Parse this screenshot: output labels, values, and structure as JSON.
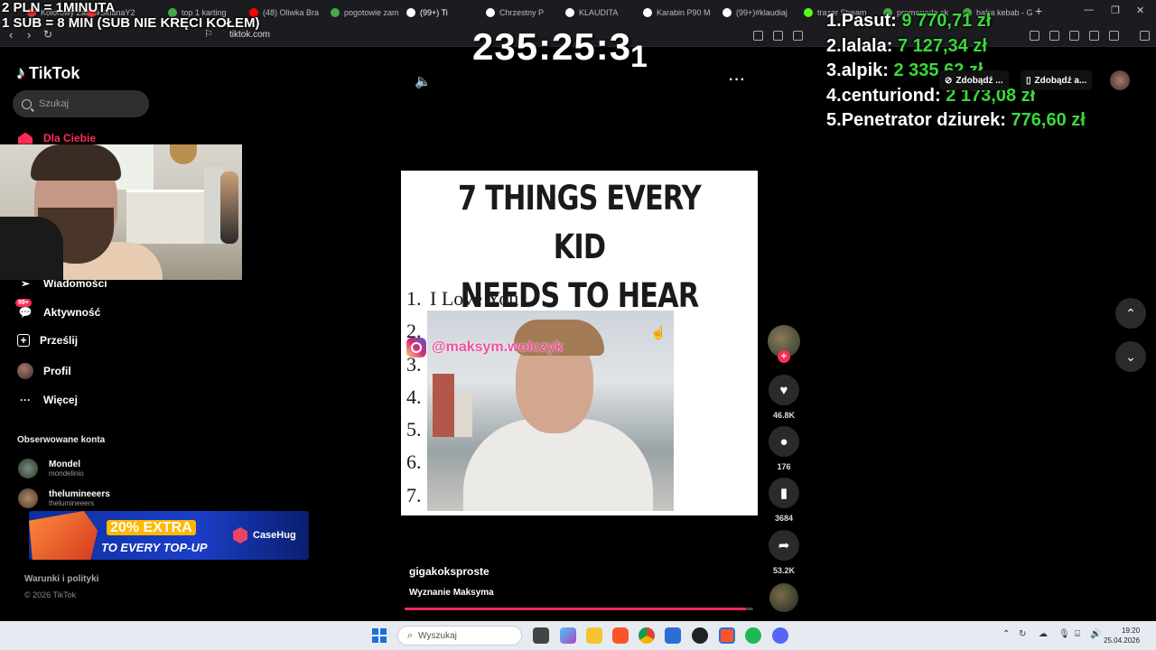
{
  "browser": {
    "tabs": [
      {
        "label": "Kolorowy Zamek",
        "color": "#d33"
      },
      {
        "label": "SklanaY2",
        "color": "#e33"
      },
      {
        "label": "top 1 karting",
        "color": "#4a4"
      },
      {
        "label": "(48) Oliwka Bra",
        "color": "#f00"
      },
      {
        "label": "pogotowie zam",
        "color": "#4a4"
      },
      {
        "label": "(99+) Ti",
        "color": "#fff"
      },
      {
        "label": "Chrzestny P",
        "color": "#fff"
      },
      {
        "label": "KLAUDITA",
        "color": "#fff"
      },
      {
        "label": "Karabin P90 M",
        "color": "#fff"
      },
      {
        "label": "(99+)#klaudiaj",
        "color": "#fff"
      },
      {
        "label": "trazer Stream",
        "color": "#53fc18"
      },
      {
        "label": "promenada sk",
        "color": "#4a4"
      },
      {
        "label": "bafra kebab - G",
        "color": "#4a4"
      }
    ],
    "url": "tiktok.com"
  },
  "stream_overlay": {
    "rate_line": "2 PLN = 1MINUTA",
    "sub_line": "1 SUB = 8 MIN (SUB NIE KRĘCI KOŁEM)",
    "timer": "235:25:3",
    "timer_last_digit": "1",
    "leaderboard": [
      {
        "rank": "1.",
        "name": "Pasut:",
        "amount": "9 770,71 zł"
      },
      {
        "rank": "2.",
        "name": "lalala:",
        "amount": "7 127,34 zł"
      },
      {
        "rank": "3.",
        "name": "alpik:",
        "amount": "2 335,62 zł"
      },
      {
        "rank": "4.",
        "name": "centuriond:",
        "amount": "2 173,08 zł"
      },
      {
        "rank": "5.",
        "name": "Penetrator dziurek:",
        "amount": "776,60 zł"
      }
    ]
  },
  "tiktok": {
    "logo": "TikTok",
    "search_placeholder": "Szukaj",
    "nav": {
      "for_you": "Dla Ciebie",
      "messages": "Wiadomości",
      "activity": "Aktywność",
      "activity_badge": "99+",
      "upload": "Prześlij",
      "profile": "Profil",
      "more": "Więcej"
    },
    "followed_title": "Obserwowane konta",
    "followed": [
      {
        "name": "Mondel",
        "handle": "mondelinio"
      },
      {
        "name": "thelumineeers",
        "handle": "thelumineeers"
      }
    ],
    "footer": {
      "terms": "Warunki i polityki",
      "copyright": "© 2026 TikTok"
    },
    "get_buttons": [
      "Zdobądź ...",
      "Zdobądź a..."
    ],
    "video": {
      "title_line1": "7 THINGS EVERY KID",
      "title_line2": "NEEDS TO HEAR",
      "list_numbers": [
        "1.",
        "2.",
        "3.",
        "4.",
        "5.",
        "6.",
        "7."
      ],
      "first_item": "I Love You",
      "instagram_handle": "@maksym.wolczyk",
      "progress": 0.98
    },
    "author": "gigakoksproste",
    "description": "Wyznanie Maksyma",
    "actions": {
      "likes": "46.8K",
      "comments": "176",
      "saves": "3684",
      "shares": "53.2K"
    }
  },
  "ad": {
    "highlight": "20% EXTRA",
    "line2": "TO EVERY TOP-UP",
    "brand": "CaseHug"
  },
  "taskbar": {
    "search_placeholder": "Wyszukaj",
    "time": "19:20",
    "date": "25.04.2026"
  }
}
